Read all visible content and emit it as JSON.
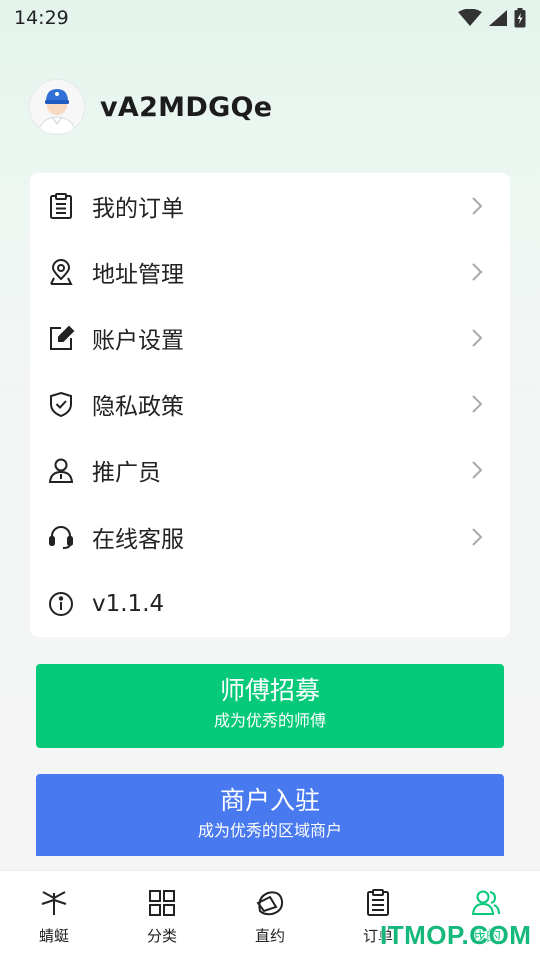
{
  "status_bar": {
    "time": "14:29"
  },
  "profile": {
    "username": "vA2MDGQe"
  },
  "menu": {
    "items": [
      {
        "label": "我的订单",
        "icon": "clipboard-icon"
      },
      {
        "label": "地址管理",
        "icon": "location-pin-icon"
      },
      {
        "label": "账户设置",
        "icon": "edit-icon"
      },
      {
        "label": "隐私政策",
        "icon": "shield-icon"
      },
      {
        "label": "推广员",
        "icon": "person-icon"
      },
      {
        "label": "在线客服",
        "icon": "headset-icon"
      },
      {
        "label": "v1.1.4",
        "icon": "info-icon"
      }
    ]
  },
  "recruit": {
    "title": "师傅招募",
    "subtitle": "成为优秀的师傅"
  },
  "merchant": {
    "title": "商户入驻",
    "subtitle": "成为优秀的区域商户"
  },
  "tabbar": {
    "tabs": [
      {
        "label": "蜻蜓",
        "icon": "dragonfly-icon"
      },
      {
        "label": "分类",
        "icon": "grid-icon"
      },
      {
        "label": "直约",
        "icon": "direct-booking-icon"
      },
      {
        "label": "订单",
        "icon": "orders-icon"
      },
      {
        "label": "我的",
        "icon": "user-profile-icon"
      }
    ],
    "active_index": 4
  },
  "watermark": {
    "text": "ITMOP.COM"
  },
  "colors": {
    "accent_green": "#06c97a",
    "merchant_blue": "#4879ef",
    "text": "#222222"
  }
}
